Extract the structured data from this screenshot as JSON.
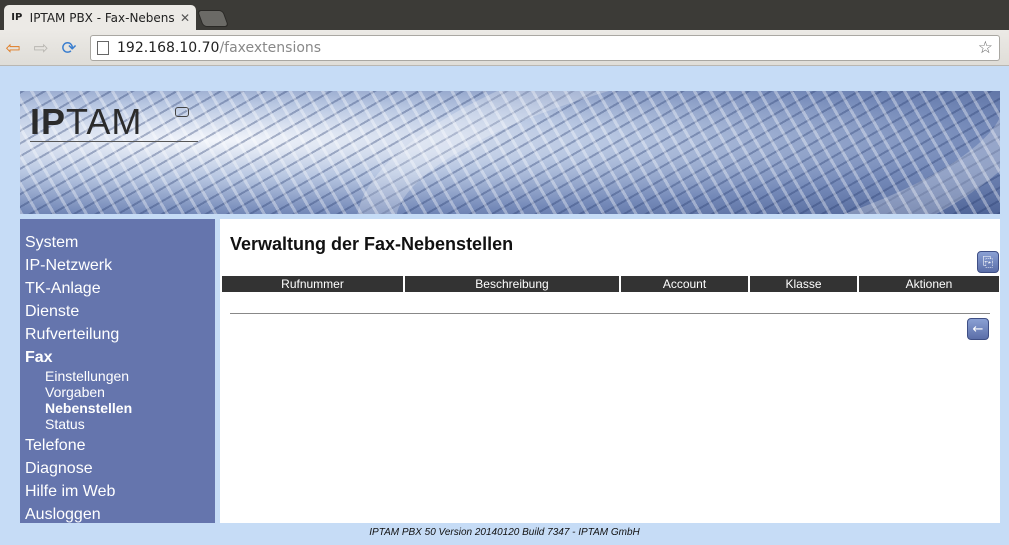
{
  "browser": {
    "tab_title": "IPTAM PBX - Fax-Nebenstellen",
    "tab_favicon": "IP",
    "tab_close": "✕",
    "url_host": "192.168.10.70",
    "url_path": "/faxextensions"
  },
  "icons": {
    "back": "back-arrow-icon",
    "forward": "forward-arrow-icon",
    "reload": "reload-icon",
    "page": "page-icon",
    "bookmark": "star-icon",
    "export": "export-icon",
    "back_page": "left-arrow-icon"
  },
  "logo": {
    "text_bold": "IP",
    "text_rest": "TAM"
  },
  "sidebar": {
    "items": [
      {
        "label": "System"
      },
      {
        "label": "IP-Netzwerk"
      },
      {
        "label": "TK-Anlage"
      },
      {
        "label": "Dienste"
      },
      {
        "label": "Rufverteilung"
      },
      {
        "label": "Fax"
      },
      {
        "label": "Telefone"
      },
      {
        "label": "Diagnose"
      },
      {
        "label": "Hilfe im Web"
      },
      {
        "label": "Ausloggen"
      }
    ],
    "fax_submenu": [
      {
        "label": "Einstellungen"
      },
      {
        "label": "Vorgaben"
      },
      {
        "label": "Nebenstellen"
      },
      {
        "label": "Status"
      }
    ]
  },
  "main": {
    "title": "Verwaltung der Fax-Nebenstellen",
    "columns": [
      "Rufnummer",
      "Beschreibung",
      "Account",
      "Klasse",
      "Aktionen"
    ]
  },
  "footer": {
    "text": "IPTAM PBX 50 Version 20140120 Build 7347 - IPTAM GmbH"
  },
  "colors": {
    "sidebar": "#6575ad",
    "page_bg": "#c6dcf6",
    "table_header": "#333333"
  }
}
